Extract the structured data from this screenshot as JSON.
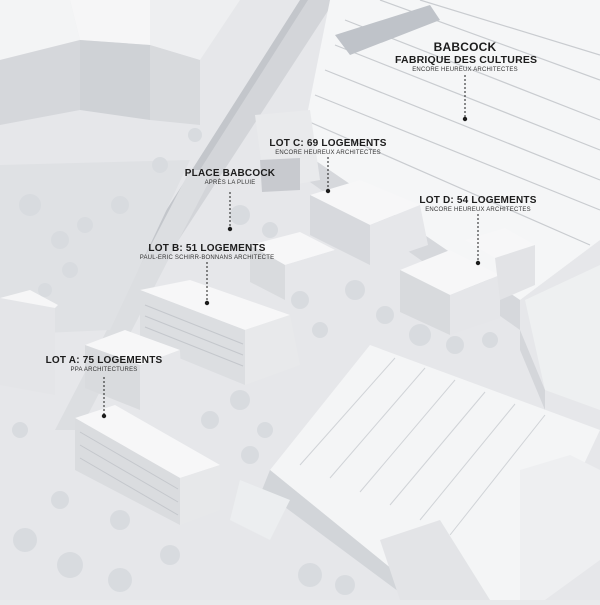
{
  "babcock": {
    "title": "BABCOCK",
    "subtitle": "FABRIQUE DES CULTURES",
    "architect": "ENCORE HEUREUX ARCHITECTES"
  },
  "place": {
    "title": "PLACE BABCOCK",
    "subtitle": "APRÈS LA PLUIE"
  },
  "lots": [
    {
      "title": "LOT A: 75 LOGEMENTS",
      "architect": "PPA ARCHITECTURES"
    },
    {
      "title": "LOT B: 51 LOGEMENTS",
      "architect": "PAUL-ERIC SCHIRR-BONNANS ARCHITECTE"
    },
    {
      "title": "LOT C: 69 LOGEMENTS",
      "architect": "ENCORE HEUREUX ARCHITECTES"
    },
    {
      "title": "LOT D: 54 LOGEMENTS",
      "architect": "ENCORE HEUREUX ARCHITECTES"
    }
  ],
  "colors": {
    "ground": "#e9eaec",
    "roof": "#f7f7f8",
    "wall": "#d9dadd",
    "shadow": "#c5c7cb",
    "tree": "#cfd2d6",
    "label": "#1c1c1c"
  }
}
